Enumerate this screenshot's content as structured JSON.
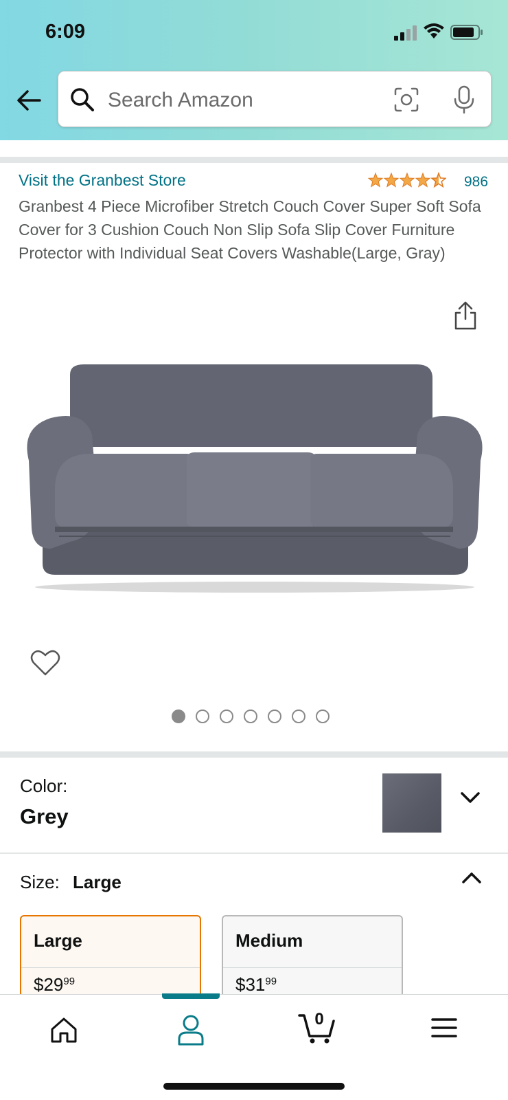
{
  "status_bar": {
    "time": "6:09"
  },
  "search": {
    "placeholder": "Search Amazon"
  },
  "product": {
    "store_link": "Visit the Granbest Store",
    "rating": 4.5,
    "rating_count": "986",
    "title": "Granbest 4 Piece Microfiber Stretch Couch Cover Super Soft Sofa Cover for 3 Cushion Couch Non Slip Sofa Slip Cover Furniture Protector with Individual Seat Covers Washable(Large, Gray)",
    "image_count": 7,
    "active_image_index": 0
  },
  "color": {
    "label": "Color:",
    "value": "Grey",
    "swatch_color": "#5f626c"
  },
  "size": {
    "label": "Size:",
    "value": "Large",
    "options": [
      {
        "name": "Large",
        "price_whole": "$29",
        "price_fraction": "99",
        "selected": true
      },
      {
        "name": "Medium",
        "price_whole": "$31",
        "price_fraction": "99",
        "selected": false
      }
    ]
  },
  "nav": {
    "items": [
      "home-icon",
      "profile-icon",
      "cart-icon",
      "menu-icon"
    ],
    "active": "profile-icon",
    "cart_count": "0"
  },
  "colors": {
    "accent": "#007185",
    "star": "#f3a847",
    "selected_border": "#e77600",
    "nav_active": "#0a7c89"
  }
}
